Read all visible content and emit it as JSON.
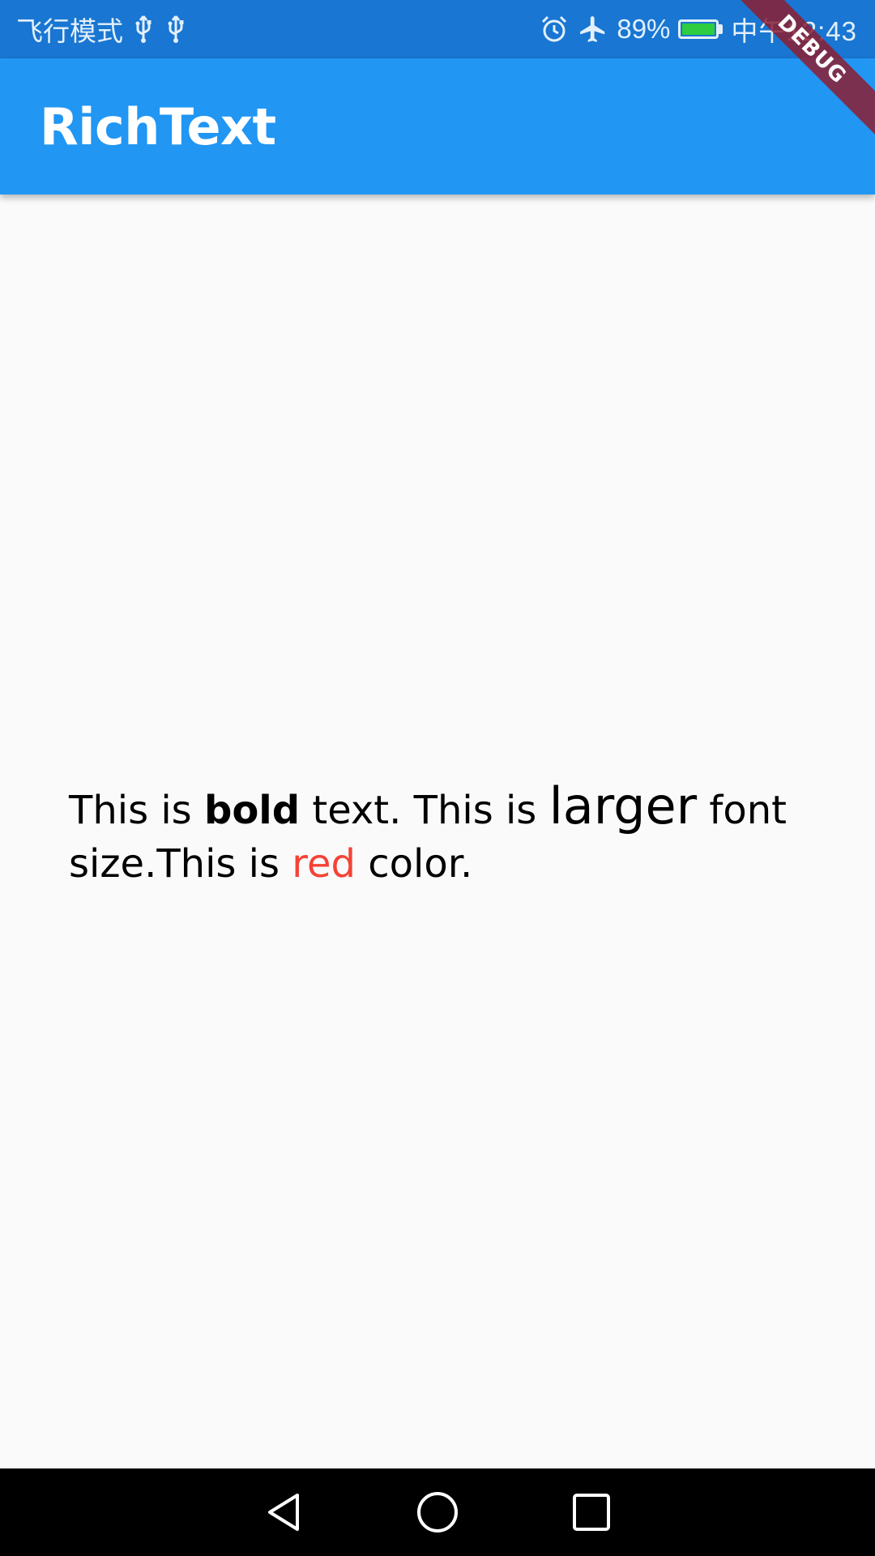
{
  "status_bar": {
    "left_text": "飞行模式",
    "battery_percent": "89%",
    "time": "中午12:43",
    "icons": [
      "usb-icon",
      "usb-icon",
      "alarm-icon",
      "airplane-icon",
      "battery-charging-icon"
    ]
  },
  "app_bar": {
    "title": "RichText"
  },
  "debug_banner": {
    "label": "DEBUG"
  },
  "rich_text": {
    "seg1": "This is ",
    "bold": "bold",
    "seg2": " text. This is ",
    "larger": "larger",
    "seg3": " font size.This is ",
    "red": "red",
    "seg4": " color."
  },
  "colors": {
    "status_bar": "#1976d2",
    "app_bar": "#2196f3",
    "background": "#fafafa",
    "red_text": "#f44336",
    "nav_bar": "#000000"
  },
  "nav_bar": {
    "icons": [
      "back-icon",
      "home-icon",
      "recents-icon"
    ]
  }
}
